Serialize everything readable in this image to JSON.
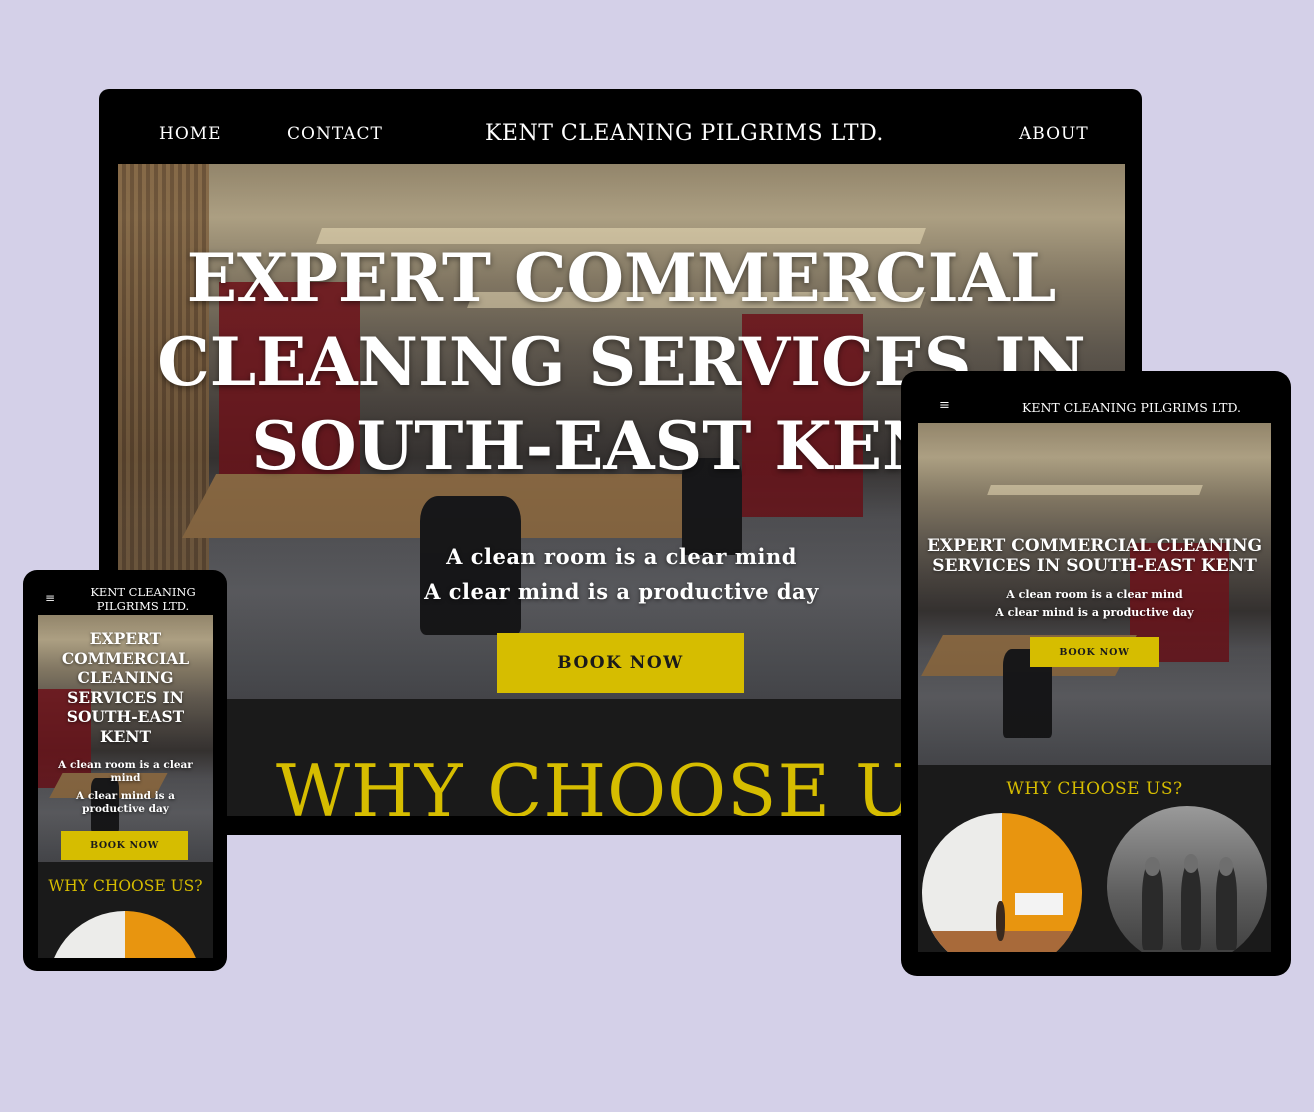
{
  "site": {
    "brand": "KENT CLEANING PILGRIMS LTD.",
    "brand_line1": "KENT CLEANING",
    "brand_line2": "PILGRIMS LTD.",
    "nav": {
      "home": "HOME",
      "contact": "CONTACT",
      "about": "ABOUT"
    },
    "menu_icon": "≡",
    "hero": {
      "title_line1": "EXPERT COMMERCIAL",
      "title_line2": "CLEANING SERVICES IN",
      "title_line3": "SOUTH-EAST KENT",
      "tablet_title_line1": "EXPERT COMMERCIAL CLEANING",
      "tablet_title_line2": "SERVICES IN SOUTH-EAST KENT",
      "phone_title_line1": "EXPERT",
      "phone_title_line2": "COMMERCIAL",
      "phone_title_line3": "CLEANING",
      "phone_title_line4": "SERVICES IN",
      "phone_title_line5": "SOUTH-EAST",
      "phone_title_line6": "KENT",
      "tagline1": "A clean room is a clear mind",
      "tagline2": "A clear mind is a productive day",
      "cta": "BOOK NOW"
    },
    "why_heading": "WHY CHOOSE US?",
    "why_heading_desktop": "WHY CHOOSE US"
  },
  "colors": {
    "background": "#d4d0e8",
    "accent": "#d6bd00",
    "frame": "#000000",
    "section_dark": "#1a1a1a",
    "orange": "#e8950f"
  }
}
